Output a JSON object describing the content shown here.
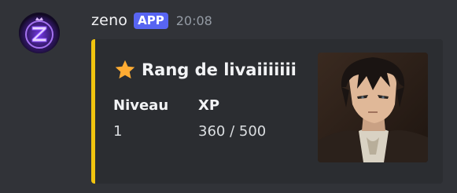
{
  "message": {
    "username": "zeno",
    "badge": "APP",
    "timestamp": "20:08",
    "avatar_icon": "zeno-z-logo-icon"
  },
  "embed": {
    "accent_color": "#f1c40f",
    "title_icon": "star-icon",
    "title": "Rang de livaiiiiiii",
    "fields": [
      {
        "name": "Niveau",
        "value": "1"
      },
      {
        "name": "XP",
        "value": "360 / 500"
      }
    ],
    "thumbnail": "anime-character-thumbnail"
  },
  "colors": {
    "background": "#313338",
    "embed_background": "#2b2d31",
    "badge": "#5865f2"
  }
}
